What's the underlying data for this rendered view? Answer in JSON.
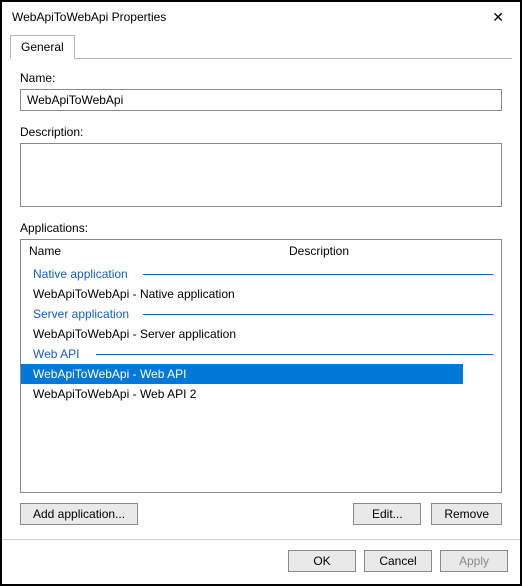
{
  "window": {
    "title": "WebApiToWebApi Properties"
  },
  "tabs": {
    "general": "General"
  },
  "fields": {
    "name_label": "Name:",
    "name_value": "WebApiToWebApi",
    "description_label": "Description:",
    "description_value": "",
    "applications_label": "Applications:"
  },
  "apps": {
    "col_name": "Name",
    "col_desc": "Description",
    "groups": [
      {
        "header": "Native application",
        "items": [
          "WebApiToWebApi - Native application"
        ]
      },
      {
        "header": "Server application",
        "items": [
          "WebApiToWebApi - Server application"
        ]
      },
      {
        "header": "Web API",
        "items": [
          "WebApiToWebApi - Web API",
          "WebApiToWebApi - Web API 2"
        ]
      }
    ],
    "selected": "WebApiToWebApi - Web API"
  },
  "buttons": {
    "add_app": "Add application...",
    "edit": "Edit...",
    "remove": "Remove",
    "ok": "OK",
    "cancel": "Cancel",
    "apply": "Apply"
  }
}
